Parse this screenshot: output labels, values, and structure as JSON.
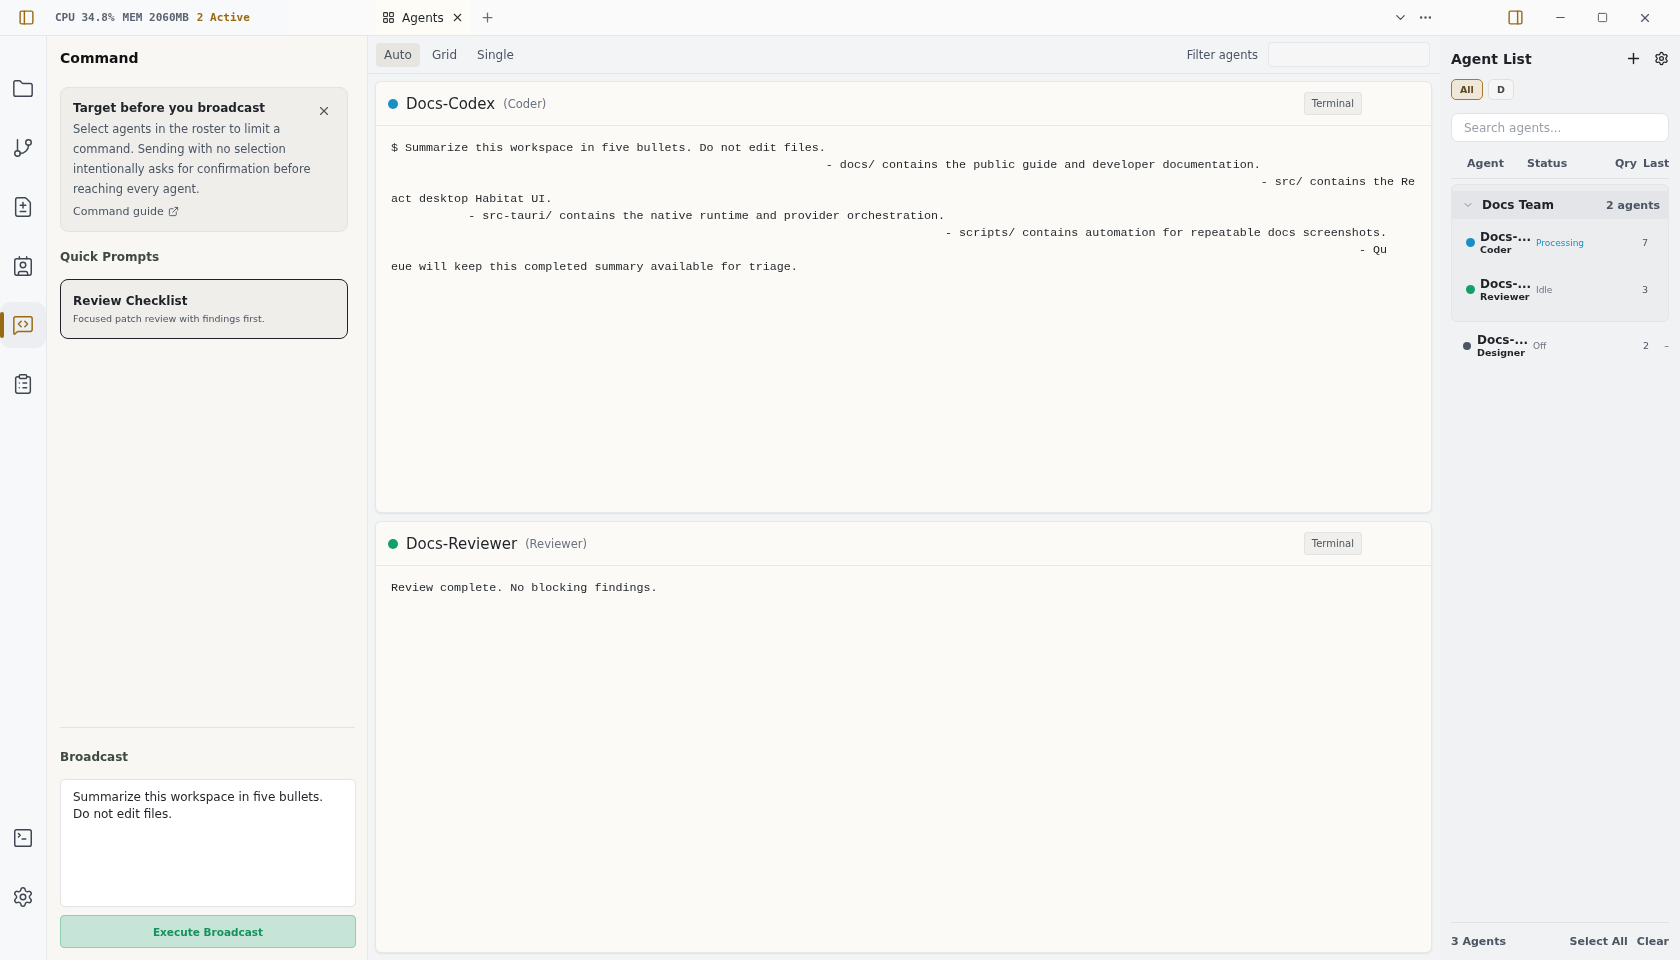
{
  "title_bar": {
    "stats": [
      {
        "text": "CPU 34.8%",
        "kind": "metric"
      },
      {
        "text": "MEM 2060MB",
        "kind": "metric"
      },
      {
        "text": "2 Active",
        "kind": "active"
      }
    ],
    "tabs": [
      {
        "label": "Agents",
        "selected": true
      }
    ],
    "right_panel_open": true
  },
  "rail": [
    {
      "selected": false
    },
    {
      "selected": false
    },
    {
      "selected": false
    },
    {
      "selected": false
    },
    {
      "selected": true
    },
    {
      "selected": false
    },
    {
      "selected": false
    },
    {
      "selected": false
    }
  ],
  "command": {
    "title": "Command",
    "notice": {
      "title": "Target before you broadcast",
      "body": "Select agents in the roster to limit a command. Sending with no selection intentionally asks for confirmation before reaching every agent.",
      "link": "Command guide"
    },
    "prompts_heading": "Quick Prompts",
    "prompts": [
      {
        "title": "Review Checklist",
        "description": "Focused patch review with findings first.",
        "selected": true
      }
    ],
    "broadcast": {
      "heading": "Broadcast",
      "value": "Summarize this workspace in five bullets. Do not edit files.",
      "button": "Execute Broadcast"
    }
  },
  "layout_tabs": [
    {
      "label": "Auto",
      "selected": true
    },
    {
      "label": "Grid",
      "selected": false
    },
    {
      "label": "Single",
      "selected": false
    }
  ],
  "filter": {
    "label": "Filter agents"
  },
  "panes": [
    {
      "name": "Docs-Codex",
      "role": "(Coder)",
      "color": "#1a8fc4",
      "button": "Terminal",
      "lines": [
        "$ Summarize this workspace in five bullets. Do not edit files.",
        "                                                              - docs/ contains the public guide and developer documentation.",
        "                                                                                                                            - src/ contains the Re",
        "act desktop Habitat UI.",
        "           - src-tauri/ contains the native runtime and provider orchestration.",
        "                                                                               - scripts/ contains automation for repeatable docs screenshots.",
        "                                                                                                                                          - Qu",
        "eue will keep this completed summary available for triage."
      ]
    },
    {
      "name": "Docs-Reviewer",
      "role": "(Reviewer)",
      "color": "#12a06a",
      "button": "Terminal",
      "lines": [
        "Review complete. No blocking findings."
      ]
    }
  ],
  "agent_list": {
    "title": "Agent List",
    "chips": [
      {
        "label": "All",
        "selected": true
      },
      {
        "label": "D",
        "selected": false
      }
    ],
    "search": {
      "placeholder": "Search agents..."
    },
    "columns": [
      "Agent",
      "Status",
      "Qry",
      "Last"
    ],
    "groups": [
      {
        "name": "Docs Team",
        "count": "2 agents",
        "expanded": true,
        "agents": [
          {
            "name": "Docs-...",
            "role": "Coder",
            "status": "Processing",
            "kind": "processing",
            "color": "#1a8fc4",
            "qry": "7"
          },
          {
            "name": "Docs-...",
            "role": "Reviewer",
            "status": "Idle",
            "kind": "idle",
            "color": "#12a06a",
            "qry": "3"
          }
        ]
      }
    ],
    "ungrouped": [
      {
        "name": "Docs-...",
        "role": "Designer",
        "status": "Off",
        "kind": "off",
        "color": "#4b5563",
        "qry": "2",
        "last": "–"
      }
    ],
    "footer": {
      "count": "3 Agents",
      "actions": [
        "Select All",
        "Clear"
      ]
    }
  }
}
